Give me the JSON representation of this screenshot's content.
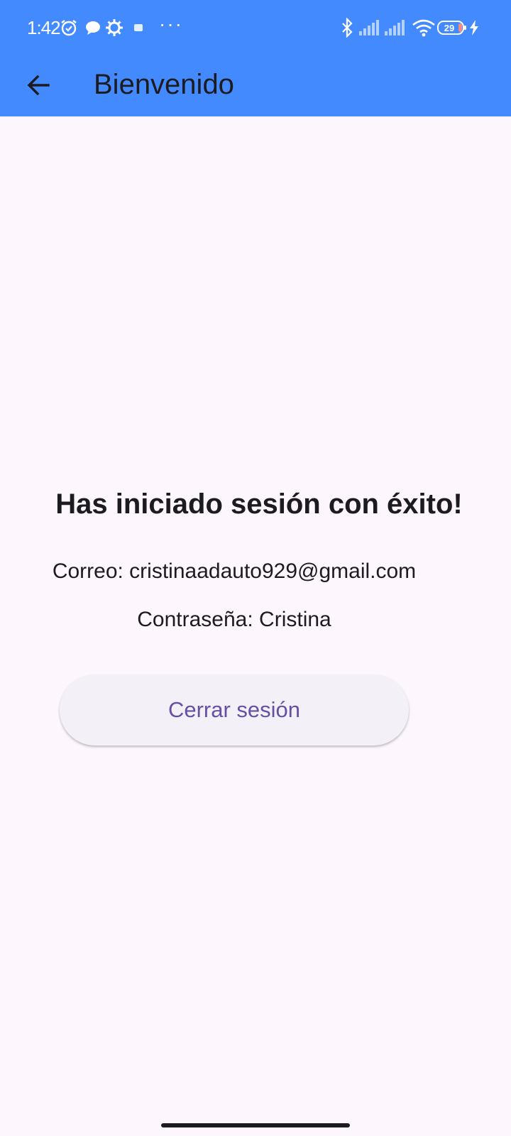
{
  "status_bar": {
    "time": "1:42",
    "overflow_dots": "···",
    "battery_level": "29",
    "icons": [
      "alarm-icon",
      "chat-bubble-icon",
      "gear-icon",
      "app-notification-icon",
      "bluetooth-icon",
      "signal-icon",
      "signal-icon",
      "wifi-icon",
      "battery-icon",
      "charging-bolt-icon"
    ],
    "background_color": "#448AFF"
  },
  "app_bar": {
    "title": "Bienvenido",
    "back_icon": "arrow-back-icon",
    "background_color": "#448AFF"
  },
  "main": {
    "headline": "Has iniciado sesión con éxito!",
    "email_text": "Correo: cristinaadauto929@gmail.com",
    "password_text": "Contraseña: Cristina",
    "logout_button_label": "Cerrar sesión",
    "accent_color": "#6750A4"
  }
}
